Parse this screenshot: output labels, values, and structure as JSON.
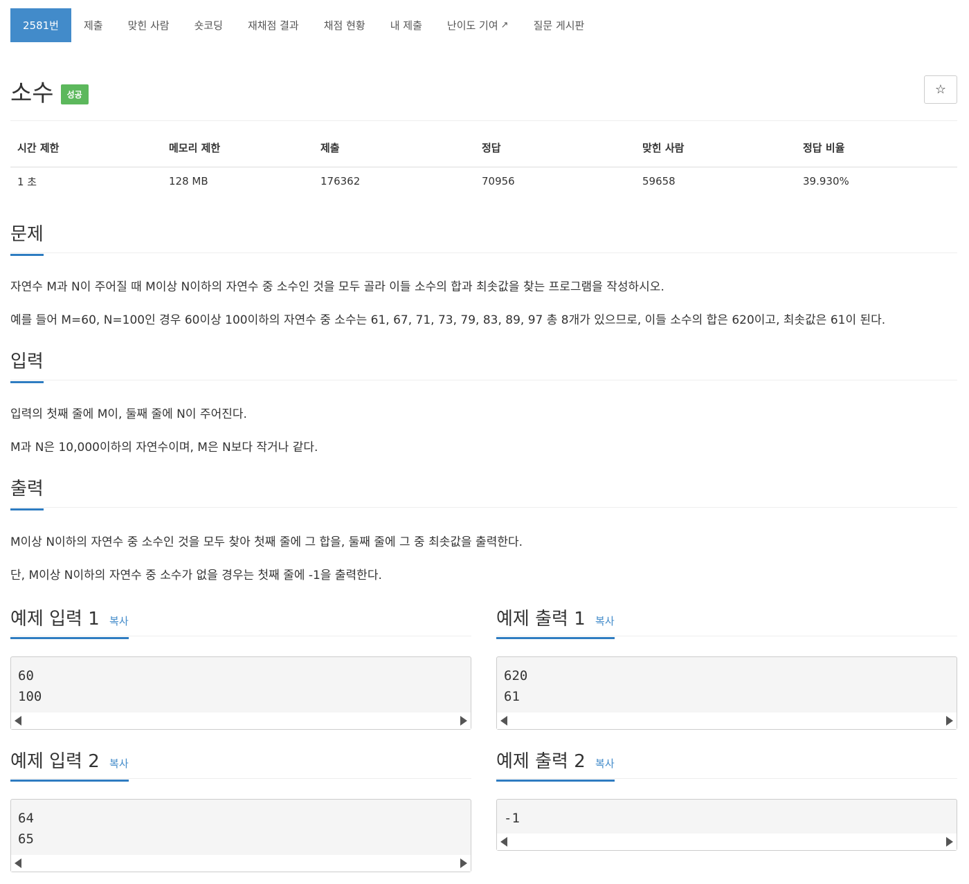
{
  "tabs": [
    {
      "label": "2581번"
    },
    {
      "label": "제출"
    },
    {
      "label": "맞힌 사람"
    },
    {
      "label": "숏코딩"
    },
    {
      "label": "재채점 결과"
    },
    {
      "label": "채점 현황"
    },
    {
      "label": "내 제출"
    },
    {
      "label": "난이도 기여"
    },
    {
      "label": "질문 게시판"
    }
  ],
  "problem": {
    "title": "소수",
    "badge": "성공",
    "star": "☆"
  },
  "stats": {
    "headers": [
      "시간 제한",
      "메모리 제한",
      "제출",
      "정답",
      "맞힌 사람",
      "정답 비율"
    ],
    "values": [
      "1 초",
      "128 MB",
      "176362",
      "70956",
      "59658",
      "39.930%"
    ]
  },
  "sections": {
    "problem_heading": "문제",
    "problem_p1": "자연수 M과 N이 주어질 때 M이상 N이하의 자연수 중 소수인 것을 모두 골라 이들 소수의 합과 최솟값을 찾는 프로그램을 작성하시오.",
    "problem_p2": "예를 들어 M=60, N=100인 경우 60이상 100이하의 자연수 중 소수는 61, 67, 71, 73, 79, 83, 89, 97 총 8개가 있으므로, 이들 소수의 합은 620이고, 최솟값은 61이 된다.",
    "input_heading": "입력",
    "input_p1": "입력의 첫째 줄에 M이, 둘째 줄에 N이 주어진다.",
    "input_p2": "M과 N은 10,000이하의 자연수이며, M은 N보다 작거나 같다.",
    "output_heading": "출력",
    "output_p1": "M이상 N이하의 자연수 중 소수인 것을 모두 찾아 첫째 줄에 그 합을, 둘째 줄에 그 중 최솟값을 출력한다.",
    "output_p2": "단, M이상 N이하의 자연수 중 소수가 없을 경우는 첫째 줄에 -1을 출력한다."
  },
  "examples": {
    "copy_label": "복사",
    "in1_title": "예제 입력 1",
    "in1_code": "60\n100",
    "out1_title": "예제 출력 1",
    "out1_code": "620\n61",
    "in2_title": "예제 입력 2",
    "in2_code": "64\n65",
    "out2_title": "예제 출력 2",
    "out2_code": "-1"
  }
}
